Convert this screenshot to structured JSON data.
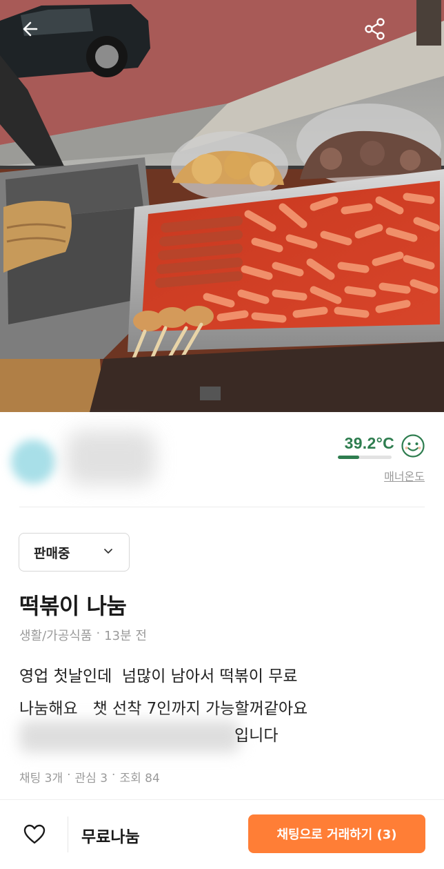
{
  "header": {
    "back_icon": "back-arrow-icon",
    "share_icon": "share-icon"
  },
  "profile": {
    "temperature": "39.2°C",
    "temperature_level_percent": 39.2,
    "temperature_label": "매너온도",
    "face_icon": "smile-face-icon",
    "accent_color": "#2e7d4f"
  },
  "post": {
    "status": "판매중",
    "title": "떡볶이 나눔",
    "category": "생활/가공식품",
    "separator": "·",
    "time_ago": "13분 전",
    "description_lines": [
      "영업 첫날인데  넘많이 남아서 떡볶이 무료",
      "나눔해요   챗 선착 7인까지 가능할꺼같아요"
    ],
    "description_visible_tail": "입니다",
    "stats": {
      "chats": "채팅 3개",
      "interests": "관심 3",
      "views": "조회 84"
    }
  },
  "bottom_bar": {
    "heart_icon": "heart-outline-icon",
    "price": "무료나눔",
    "chat_button": "채팅으로 거래하기 (3)",
    "button_color": "#ff7e36"
  }
}
